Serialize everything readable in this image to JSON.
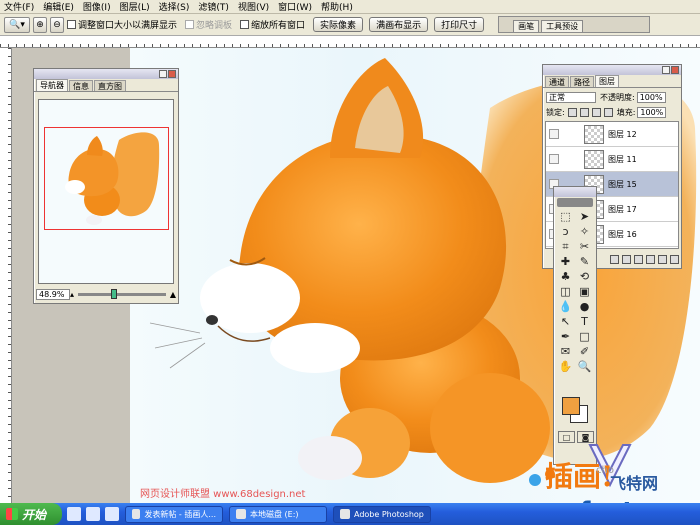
{
  "menubar": {
    "items": [
      "文件(F)",
      "编辑(E)",
      "图像(I)",
      "图层(L)",
      "选择(S)",
      "滤镜(T)",
      "视图(V)",
      "窗口(W)",
      "帮助(H)"
    ]
  },
  "options": {
    "fit_window_label": "调整窗口大小以满屏显示",
    "ignore_palettes_label": "忽略调板",
    "zoom_all_label": "缩放所有窗口",
    "actual_pixels_label": "实际像素",
    "fit_screen_label": "满画布显示",
    "print_size_label": "打印尺寸",
    "palette_well_tabs": [
      "画笔",
      "工具预设"
    ]
  },
  "navigator": {
    "tabs": [
      "导航器",
      "信息",
      "直方图"
    ],
    "zoom": "48.9%"
  },
  "layers": {
    "tabs": [
      "通道",
      "路径",
      "图层"
    ],
    "blend_mode": "正常",
    "opacity_label": "不透明度:",
    "opacity": "100%",
    "lock_label": "锁定:",
    "fill_label": "填充:",
    "fill": "100%",
    "rows": [
      {
        "name": "图层 12",
        "selected": false
      },
      {
        "name": "图层 11",
        "selected": false
      },
      {
        "name": "图层 15",
        "selected": true
      },
      {
        "name": "图层 17",
        "selected": false
      },
      {
        "name": "图层 16",
        "selected": false
      }
    ]
  },
  "toolbox": {
    "tools": [
      "marquee-icon",
      "move-icon",
      "lasso-icon",
      "magic-wand-icon",
      "crop-icon",
      "slice-icon",
      "healing-icon",
      "brush-icon",
      "stamp-icon",
      "history-brush-icon",
      "eraser-icon",
      "gradient-icon",
      "blur-icon",
      "dodge-icon",
      "path-select-icon",
      "type-icon",
      "pen-icon",
      "shape-icon",
      "notes-icon",
      "eyedropper-icon",
      "hand-icon",
      "zoom-icon"
    ],
    "glyphs": [
      "⬚",
      "➤",
      "ↄ",
      "✧",
      "⌗",
      "✂",
      "✚",
      "✎",
      "♣",
      "⟲",
      "◫",
      "▣",
      "💧",
      "●",
      "↖",
      "T",
      "✒",
      "□",
      "✉",
      "✐",
      "✋",
      "🔍"
    ],
    "foreground": "#f0a040",
    "background": "#ffffff"
  },
  "watermark": {
    "url": "网页设计师联盟 www.68design.net",
    "big_text": "插画!",
    "site_partial": "cho",
    "brand": "飞特网",
    "site_url": "fevte.com"
  },
  "taskbar": {
    "start": "开始",
    "tasks": [
      "发表新帖 - 插画人...",
      "本地磁盘 (E:)",
      "Adobe Photoshop"
    ]
  }
}
